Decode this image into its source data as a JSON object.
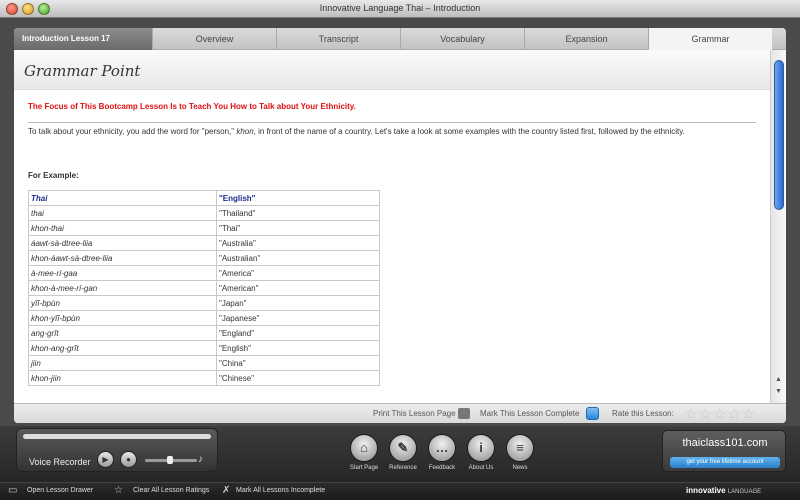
{
  "window": {
    "title": "Innovative Language Thai – Introduction"
  },
  "tabs": {
    "lesson": "Introduction Lesson 17",
    "items": [
      "Overview",
      "Transcript",
      "Vocabulary",
      "Expansion",
      "Grammar"
    ],
    "active": "Grammar"
  },
  "content": {
    "heading": "Grammar Point",
    "focus": "The Focus of This Bootcamp Lesson Is to Teach You How to Talk about Your Ethnicity.",
    "intro_pre": "To talk about your ethnicity, you add the word for \"person,\" ",
    "intro_em": "khon",
    "intro_post": ", in front of the name of a country. Let's take a look at some examples with the country listed first, followed by the ethnicity.",
    "for_example": "For Example:",
    "table": {
      "headers": [
        "Thai",
        "\"English\""
      ],
      "rows": [
        [
          "thai",
          "\"Thailand\""
        ],
        [
          "khon-thai",
          "\"Thai\""
        ],
        [
          "áawt-sà-dtree-liia",
          "\"Australia\""
        ],
        [
          "khon-áawt-sà-dtree-liia",
          "\"Australian\""
        ],
        [
          "à-mee-rí-gaa",
          "\"America\""
        ],
        [
          "khon-à-mee-rí-gan",
          "\"American\""
        ],
        [
          "yîî-bpùn",
          "\"Japan\""
        ],
        [
          "khon-yîî-bpùn",
          "\"Japanese\""
        ],
        [
          "ang-grît",
          "\"England\""
        ],
        [
          "khon-ang-grît",
          "\"English\""
        ],
        [
          "jiin",
          "\"China\""
        ],
        [
          "khon-jiin",
          "\"Chinese\""
        ]
      ]
    }
  },
  "footer": {
    "print": "Print This Lesson Page",
    "mark_complete": "Mark This Lesson Complete",
    "rate": "Rate this Lesson:",
    "stars": "☆☆☆☆☆"
  },
  "recorder": {
    "label": "Voice Recorder",
    "play": "▶",
    "stop": "●",
    "volume": "♪"
  },
  "nav": [
    {
      "label": "Start Page",
      "icon": "⌂"
    },
    {
      "label": "Reference",
      "icon": "✎"
    },
    {
      "label": "Feedback",
      "icon": "…"
    },
    {
      "label": "About Us",
      "icon": "i"
    },
    {
      "label": "News",
      "icon": "≡"
    }
  ],
  "brand": {
    "site": "thaiclass101.com",
    "cta": "get your free lifetime account"
  },
  "statusbar": {
    "open_drawer": "Open Lesson Drawer",
    "clear_ratings": "Clear All Lesson Ratings",
    "mark_incomplete": "Mark All Lessons Incomplete",
    "logo_main": "innovative",
    "logo_sub": "LANGUAGE"
  },
  "colors": {
    "focus_red": "#dd1111",
    "header_blue": "#1a2a8a",
    "accent_blue": "#2a86d8"
  }
}
